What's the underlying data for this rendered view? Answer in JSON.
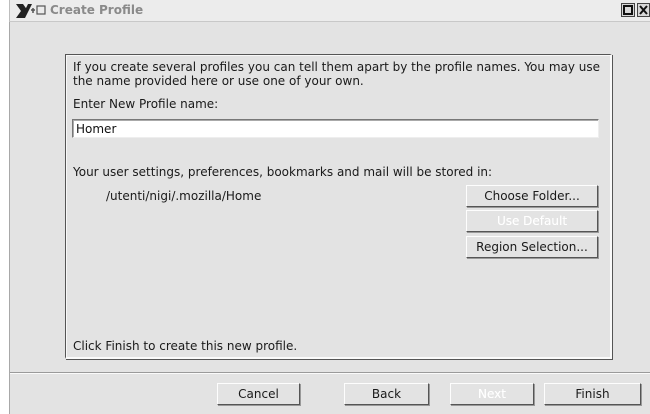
{
  "window": {
    "title": "Create Profile",
    "icons": [
      "x-window-logo-icon",
      "maximize-icon",
      "close-icon"
    ]
  },
  "intro_text": "If you create several profiles you can tell them apart by the profile names. You may use the name provided here or use one of your own.",
  "name_label": "Enter New Profile name:",
  "profile_name": "Homer",
  "storage_label": "Your user settings, preferences, bookmarks and mail will be stored in:",
  "storage_path": "/utenti/nigi/.mozilla/Home",
  "buttons": {
    "choose_folder": "Choose Folder...",
    "use_default": "Use Default",
    "region_selection": "Region Selection..."
  },
  "finish_hint": "Click Finish to create this new profile.",
  "nav": {
    "cancel": "Cancel",
    "back": "Back",
    "next": "Next",
    "finish": "Finish"
  }
}
